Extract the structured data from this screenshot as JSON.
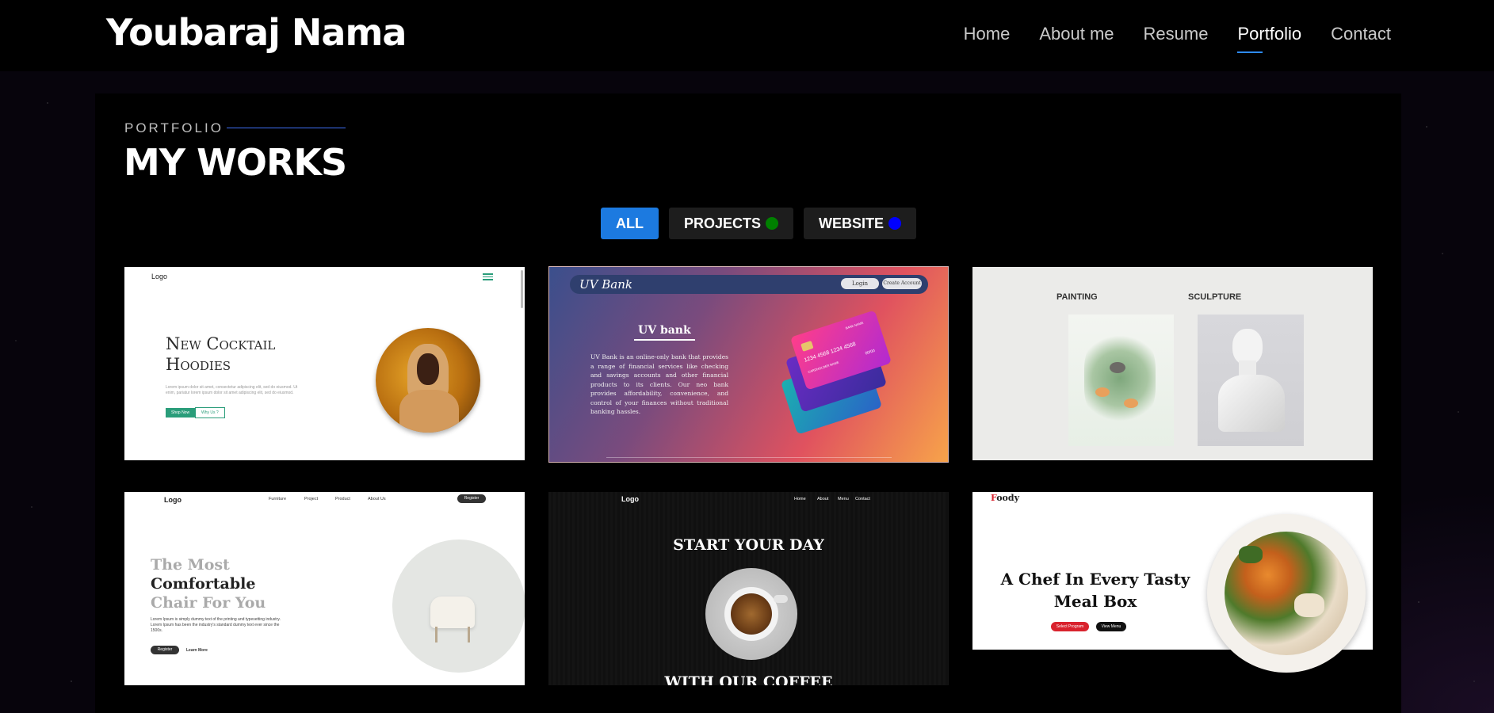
{
  "header": {
    "brand": "Youbaraj Nama",
    "nav": [
      "Home",
      "About me",
      "Resume",
      "Portfolio",
      "Contact"
    ],
    "active_nav": "Portfolio"
  },
  "section": {
    "label": "PORTFOLIO",
    "title": "MY WORKS"
  },
  "filters": [
    {
      "label": "ALL",
      "active": true
    },
    {
      "label": "PROJECTS",
      "dot_color": "#008000"
    },
    {
      "label": "WEBSITE",
      "dot_color": "#0000ff"
    }
  ],
  "colors": {
    "accent": "#1c7ae0",
    "nav_underline": "#2e8bff"
  },
  "cards": {
    "hoodies": {
      "logo": "Logo",
      "heading_line1": "New Cocktail",
      "heading_line2": "Hoodies",
      "text": "Lorem ipsum dolor sit amet, consectetur adipiscing elit, sed do eiusmod. Ut enim, pariatur lorem ipsum dolor sit amet adipiscing elit, sed do eiusmod.",
      "btn1": "Shop Now",
      "btn2": "Why Us ?"
    },
    "uvbank": {
      "brand": "UV Bank",
      "login": "Login",
      "create": "Create Account",
      "heading": "UV bank",
      "text": "UV Bank is an online-only bank that provides a range of financial services like checking and savings accounts and other financial products to its clients. Our neo bank provides affordability, convenience, and control of your finances without traditional banking hassles.",
      "card_number": "1234 4568 1234 4568",
      "card_name": "CARDHOLDER NAME",
      "bank_name": "BANK NAME",
      "expiry": "00/00"
    },
    "art": {
      "label1": "PAINTING",
      "label2": "SCULPTURE"
    },
    "chair": {
      "logo": "Logo",
      "nav": [
        "Furniture",
        "Project",
        "Product",
        "About Us"
      ],
      "register": "Register",
      "line1": "The Most",
      "line2": "Comfortable",
      "line3": "Chair For You",
      "text": "Lorem Ipsum is simply dummy text of the printing and typesetting industry. Lorem Ipsum has been the industry's standard dummy text ever since the 1500s.",
      "btn1": "Register",
      "btn2": "Learn More"
    },
    "coffee": {
      "logo": "Logo",
      "nav": [
        "Home",
        "About",
        "Menu",
        "Contact"
      ],
      "line1": "START YOUR DAY",
      "line2": "WITH OUR COFFEE"
    },
    "foody": {
      "logo_red": "F",
      "logo_rest": "oody",
      "heading": "A Chef In Every Tasty Meal Box",
      "btn1": "Select Program",
      "btn2": "View Menu"
    }
  }
}
